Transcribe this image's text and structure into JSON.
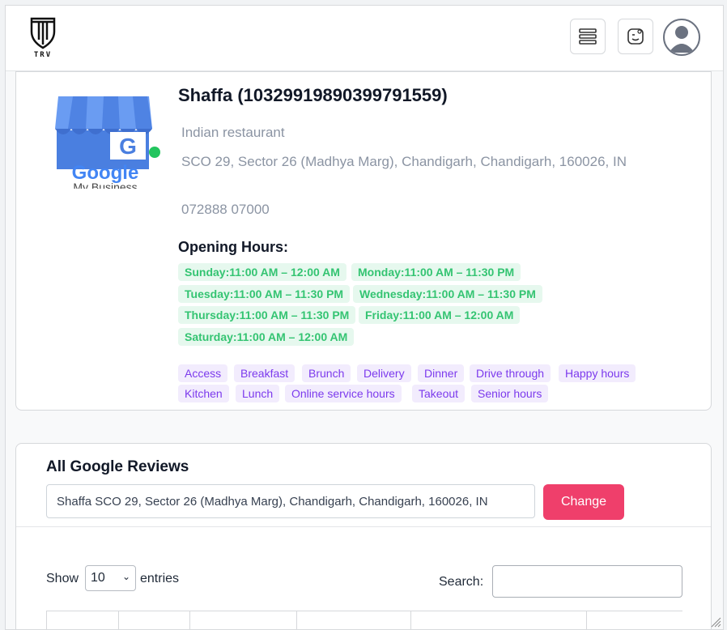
{
  "header": {
    "logo_text": "TRV",
    "icons": [
      "menu-stack-icon",
      "emoji-icon",
      "user-avatar-icon"
    ]
  },
  "business": {
    "name": "Shaffa (10329919890399791559)",
    "category": "Indian restaurant",
    "address": "SCO 29, Sector 26 (Madhya Marg), Chandigarh, Chandigarh, 160026, IN",
    "phone": "072888 07000",
    "logo": {
      "word": "Google",
      "sub": "My Business"
    },
    "status_color": "#34c472"
  },
  "opening_hours": {
    "title": "Opening Hours:",
    "days": [
      "Sunday:11:00 AM – 12:00 AM",
      "Monday:11:00 AM – 11:30 PM",
      "Tuesday:11:00 AM – 11:30 PM",
      "Wednesday:11:00 AM – 11:30 PM",
      "Thursday:11:00 AM – 11:30 PM",
      "Friday:11:00 AM – 12:00 AM",
      "Saturday:11:00 AM – 12:00 AM"
    ]
  },
  "tags": [
    "Access",
    "Breakfast",
    "Brunch",
    "Delivery",
    "Dinner",
    "Drive through",
    "Happy hours",
    "Kitchen",
    "Lunch",
    "Online service hours",
    "Takeout",
    "Senior hours"
  ],
  "reviews": {
    "title": "All Google Reviews",
    "location_value": "Shaffa SCO 29, Sector 26 (Madhya Marg), Chandigarh, Chandigarh, 160026, IN",
    "change_label": "Change",
    "show_label": "Show",
    "entries_value": "10",
    "entries_label": "entries",
    "search_label": "Search:",
    "search_value": ""
  },
  "colors": {
    "accent": "#ef3f6b",
    "hours_text": "#34c472",
    "hours_bg": "#e6f8ee",
    "tag_text": "#7c3aed",
    "tag_bg": "#f2ecfd"
  }
}
